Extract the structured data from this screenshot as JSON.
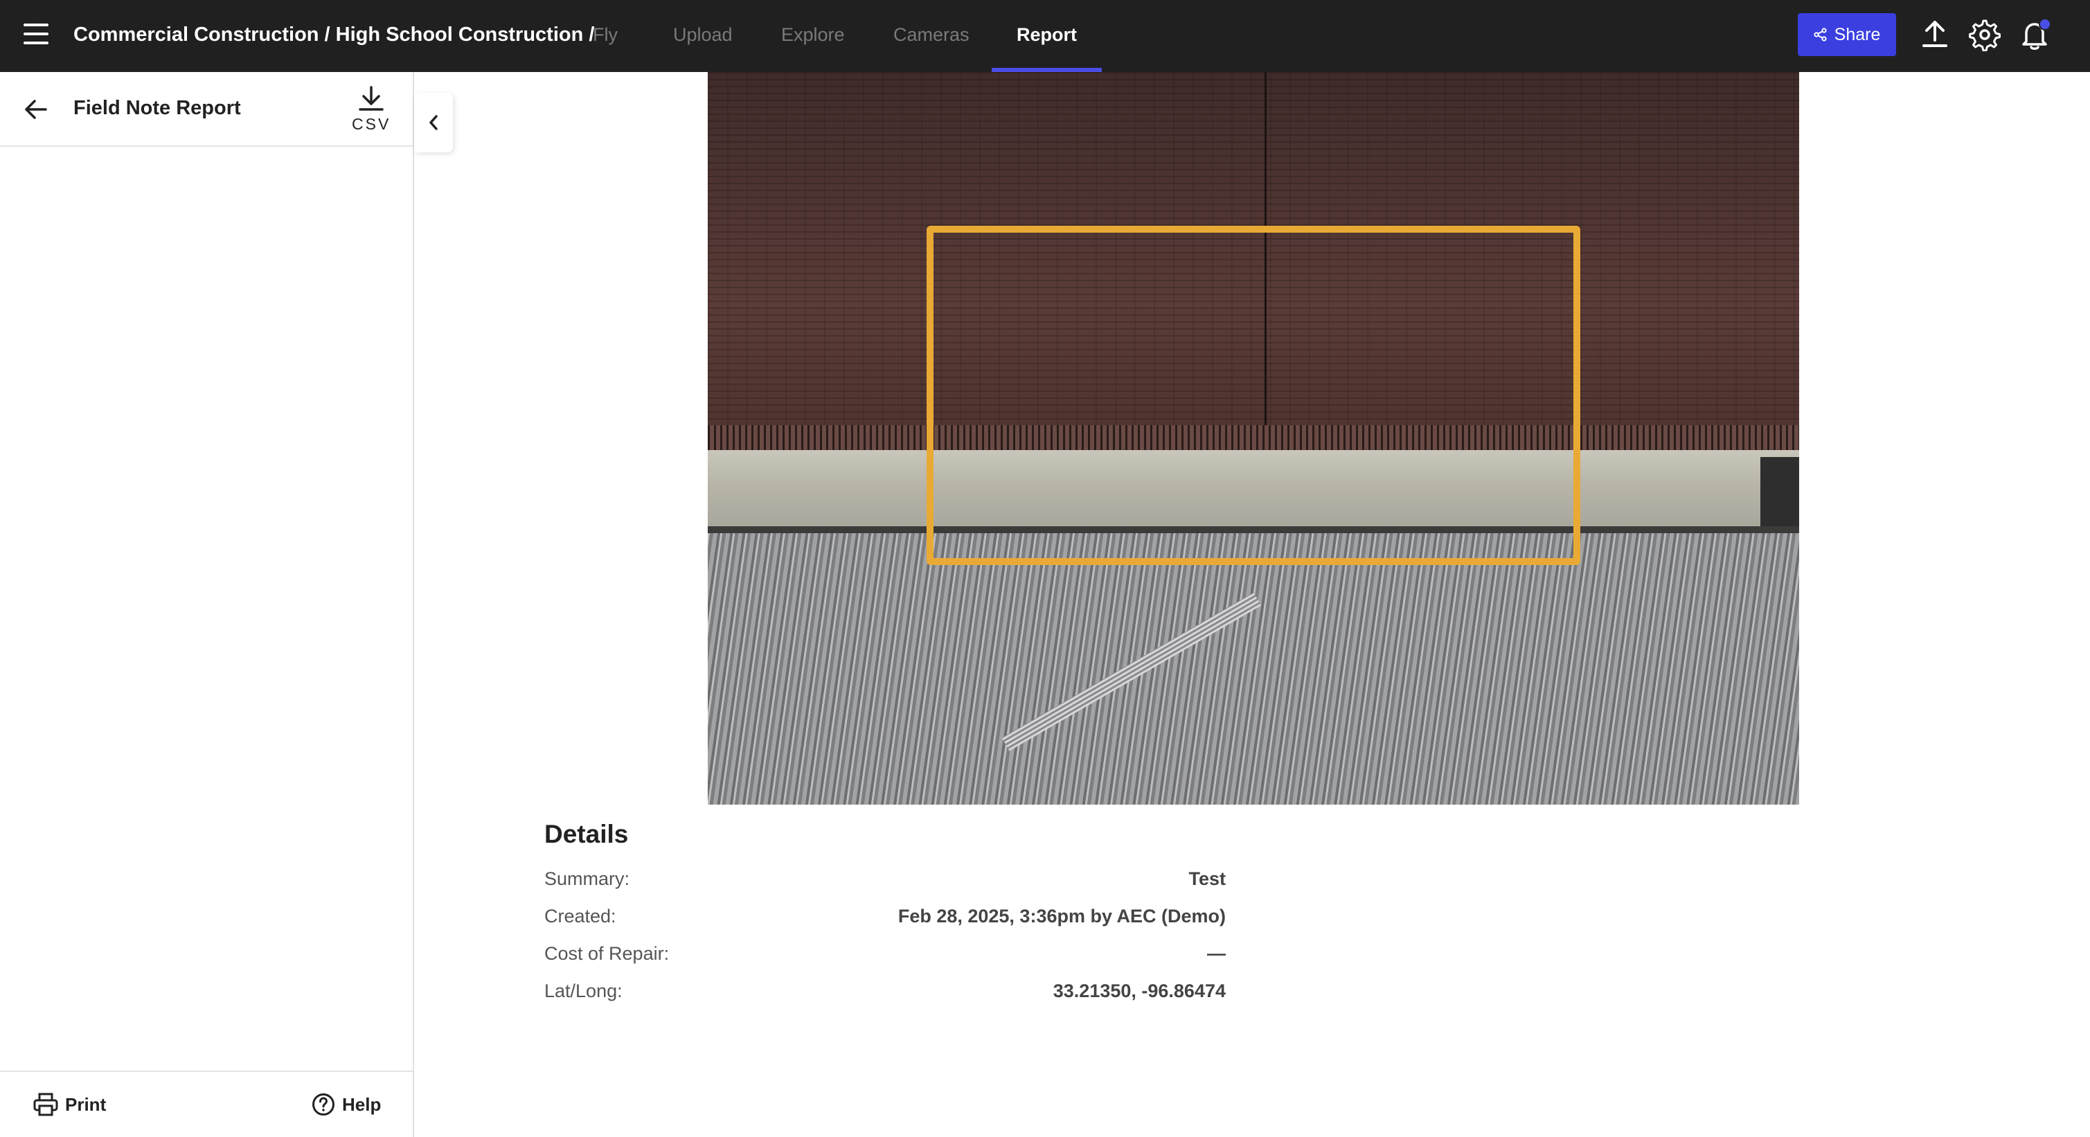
{
  "topbar": {
    "breadcrumb": "Commercial Construction / High School Construction /",
    "tabs": [
      {
        "label": "Fly",
        "active": false
      },
      {
        "label": "Upload",
        "active": false
      },
      {
        "label": "Explore",
        "active": false
      },
      {
        "label": "Cameras",
        "active": false
      },
      {
        "label": "Report",
        "active": true
      }
    ],
    "share_label": "Share",
    "icons": [
      "menu-icon",
      "share-icon",
      "upload-icon",
      "gear-icon",
      "bell-icon"
    ],
    "accent_color": "#3b3fe0"
  },
  "sidebar": {
    "title": "Field Note Report",
    "csv_label": "CSV",
    "print_label": "Print",
    "help_label": "Help"
  },
  "annotation": {
    "color": "#e9aa35"
  },
  "details": {
    "title": "Details",
    "rows": [
      {
        "label": "Summary:",
        "value": "Test"
      },
      {
        "label": "Created:",
        "value": "Feb 28, 2025, 3:36pm by AEC (Demo)"
      },
      {
        "label": "Cost of Repair:",
        "value": "—"
      },
      {
        "label": "Lat/Long:",
        "value": "33.21350, -96.86474"
      }
    ]
  }
}
